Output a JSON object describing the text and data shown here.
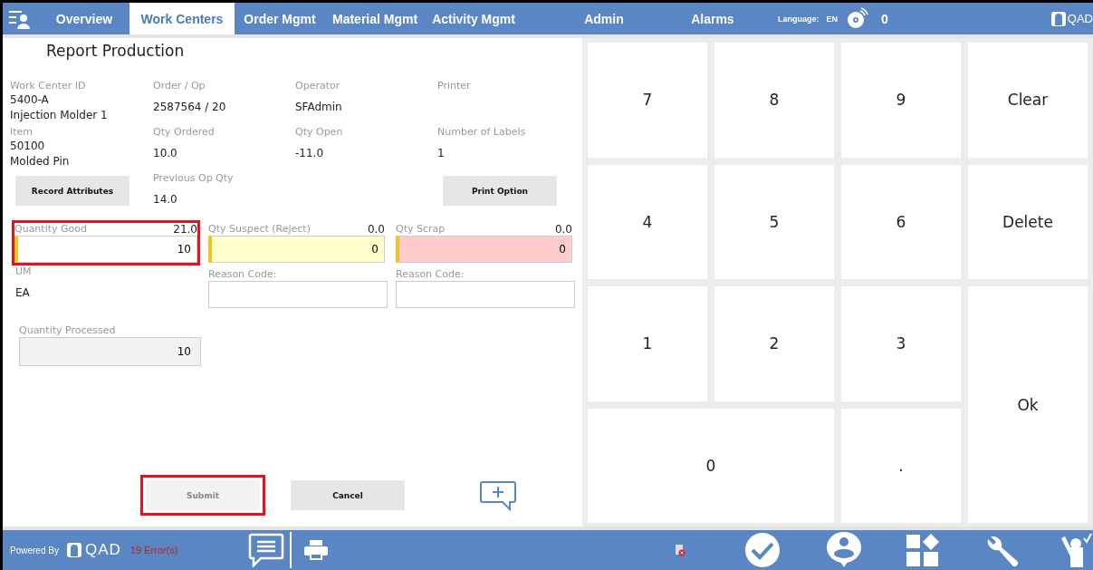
{
  "header": {
    "tabs": [
      {
        "label": "Overview",
        "selected": false
      },
      {
        "label": "Work Centers",
        "selected": true
      },
      {
        "label": "Order Mgmt",
        "selected": false
      },
      {
        "label": "Material Mgmt",
        "selected": false
      },
      {
        "label": "Activity Mgmt",
        "selected": false
      },
      {
        "label": "Admin",
        "selected": false
      },
      {
        "label": "Alarms",
        "selected": false
      }
    ],
    "language_label": "Language:",
    "language": "EN",
    "alarm_count": "0",
    "logo": "QAD"
  },
  "page_title": "Report Production",
  "info_rows": [
    [
      {
        "kind": "field",
        "label": "Work Center ID",
        "values": [
          "5400-A",
          "Injection Molder 1"
        ]
      },
      {
        "kind": "field",
        "label": "Order / Op",
        "values": [
          "2587564 / 20"
        ]
      },
      {
        "kind": "field",
        "label": "Operator",
        "values": [
          "SFAdmin"
        ]
      },
      {
        "kind": "field",
        "label": "Printer"
      }
    ],
    [
      {
        "kind": "field",
        "label": "Item",
        "values": [
          "50100",
          "Molded Pin"
        ]
      },
      {
        "kind": "field",
        "label": "Qty Ordered",
        "values": [
          "10.0"
        ]
      },
      {
        "kind": "field",
        "label": "Qty Open",
        "values": [
          "-11.0"
        ]
      },
      {
        "kind": "field",
        "label": "Number of Labels",
        "values": [
          "1"
        ]
      }
    ],
    [
      {
        "kind": "button",
        "label": "Record Attributes"
      },
      {
        "kind": "field",
        "label": "Previous Op Qty",
        "values": [
          "14.0"
        ]
      },
      {
        "kind": "button",
        "label": "Print Option"
      }
    ]
  ],
  "quantities": [
    {
      "label": "Quantity Good",
      "total": "21.0",
      "value": "10",
      "color": "#ffffff",
      "highlighted": true
    },
    {
      "label": "Qty Suspect (Reject)",
      "total": "0.0",
      "value": "0",
      "color": "#ffffcc",
      "highlighted": false,
      "reason_label": "Reason Code:"
    },
    {
      "label": "Qty Scrap",
      "total": "0.0",
      "value": "0",
      "color": "#ffcccc",
      "highlighted": false,
      "reason_label": "Reason Code:"
    }
  ],
  "um": {
    "label": "UM",
    "value": "EA"
  },
  "processed": {
    "label": "Quantity Processed",
    "value": "10"
  },
  "actions": [
    {
      "label": "Submit",
      "disabled": true,
      "highlighted": true
    },
    {
      "label": "Cancel",
      "disabled": false,
      "highlighted": false
    }
  ],
  "keypad": [
    {
      "label": "7",
      "kind": "key"
    },
    {
      "label": "8",
      "kind": "key"
    },
    {
      "label": "9",
      "kind": "key"
    },
    {
      "label": "Clear",
      "kind": "key"
    },
    {
      "label": "4",
      "kind": "key"
    },
    {
      "label": "5",
      "kind": "key"
    },
    {
      "label": "6",
      "kind": "key"
    },
    {
      "label": "Delete",
      "kind": "key"
    },
    {
      "label": "1",
      "kind": "key"
    },
    {
      "label": "2",
      "kind": "key"
    },
    {
      "label": "3",
      "kind": "key"
    },
    {
      "label": "Ok",
      "kind": "tall"
    },
    {
      "label": "0",
      "kind": "wide"
    },
    {
      "label": ".",
      "kind": "key"
    }
  ],
  "footer": {
    "powered_by": "Powered By",
    "logo": "QAD",
    "errors": "19 Error(s)"
  }
}
